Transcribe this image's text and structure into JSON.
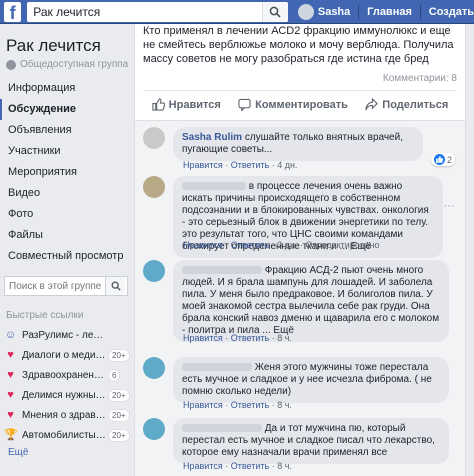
{
  "topbar": {
    "logo": "f",
    "search_value": "Рак лечится",
    "user_name": "Sasha",
    "home_label": "Главная",
    "create_label": "Создать"
  },
  "left": {
    "group_title": "Рак лечится",
    "group_type": "Общедоступная группа",
    "nav": [
      "Информация",
      "Обсуждение",
      "Объявления",
      "Участники",
      "Мероприятия",
      "Видео",
      "Фото",
      "Файлы",
      "Совместный просмотр"
    ],
    "search_placeholder": "Поиск в этой группе",
    "shortcuts_title": "Быстрые ссылки",
    "shortcuts": [
      {
        "icon": "☺",
        "label": "РазРулимс - лечение, ...",
        "badge": ""
      },
      {
        "icon": "♥",
        "label": "Диалоги о медицине",
        "badge": "20+"
      },
      {
        "icon": "♥",
        "label": "Здравоохранение в ...",
        "badge": "6"
      },
      {
        "icon": "♥",
        "label": "Делимся нужными...",
        "badge": "20+"
      },
      {
        "icon": "♥",
        "label": "Мнения о здравоох...",
        "badge": "20+"
      },
      {
        "icon": "🏆",
        "label": "Автомобилисты М...",
        "badge": "20+"
      }
    ],
    "more_label": "Ещё"
  },
  "post": {
    "text": "Кто применял в лечении АСD2 фракцию иммунолюкс и еще не смейтесь верблюжье молоко и мочу верблюда. Получила массу советов не могу разобраться где истина где бред",
    "comments_count": "Комментарии: 8",
    "like_label": "Нравится",
    "comment_label": "Комментировать",
    "share_label": "Поделиться"
  },
  "comments": [
    {
      "name": "Sasha Rulim",
      "text": "слушайте только внятных врачей, пугающие советы...",
      "like": "Нравится",
      "reply": "Ответить",
      "time": "4 дн.",
      "extra": "",
      "reactions": "2"
    },
    {
      "name": "",
      "text": "в процессе лечения очень важно искать причины происходящего в собственном подсознании и в блокированных чувствах. онкология - это серьезный блок в движении энергетики по телу. это результат того, что ЦНС своими командами блокирует определенные ткани и ... Ещё",
      "like": "Нравится",
      "reply": "Ответить",
      "time": "3 дн.",
      "extra": "Отредактировано",
      "reactions": ""
    },
    {
      "name": "",
      "text": "Фракцию АСД-2 пьют очень много людей. И я брала шампунь для лошадей. И заболела пила. У меня было предраковое. И болиголов пила. У моей знакомой сестра вылечила себе рак груди. Она брала конский навоз дменю и щаварила его с молоком - политра и пила ... Ещё",
      "like": "Нравится",
      "reply": "Ответить",
      "time": "8 ч.",
      "extra": "",
      "reactions": ""
    },
    {
      "name": "",
      "text": "Женя этого мужчины тоже перестала есть мучное и сладкое и у нее исчезла фиброма. ( не помню сколько недели)",
      "like": "Нравится",
      "reply": "Ответить",
      "time": "8 ч.",
      "extra": "",
      "reactions": ""
    },
    {
      "name": "",
      "text": "Да и тот мужчина пю, который перестал есть мучное и сладкое писал что лекарство, которое ему назначали врачи применял все",
      "like": "Нравится",
      "reply": "Ответить",
      "time": "8 ч.",
      "extra": "",
      "reactions": ""
    }
  ]
}
